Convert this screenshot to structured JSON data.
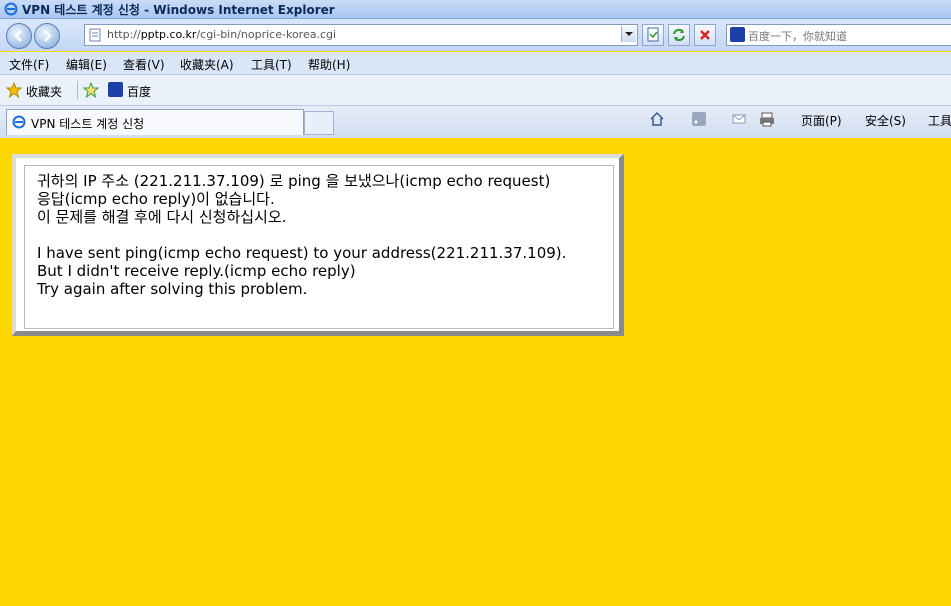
{
  "window": {
    "title": "VPN 테스트 계정 신청 - Windows Internet Explorer"
  },
  "address": {
    "url_prefix": "http://",
    "host": "pptp.co.kr",
    "path": "/cgi-bin/noprice-korea.cgi"
  },
  "search": {
    "placeholder": "百度一下，你就知道"
  },
  "menu": [
    "文件(F)",
    "编辑(E)",
    "查看(V)",
    "收藏夹(A)",
    "工具(T)",
    "帮助(H)"
  ],
  "favorites": {
    "favorites_label": "收藏夹",
    "baidu_label": "百度"
  },
  "tab": {
    "label": "VPN 테스트 계정 신청"
  },
  "commandbar": {
    "page": "页面(P)",
    "safety": "安全(S)",
    "tools": "工具"
  },
  "content": {
    "lines": [
      "귀하의 IP 주소 (221.211.37.109) 로 ping 을 보냈으나(icmp echo request)",
      "응답(icmp echo reply)이 없습니다.",
      "이 문제를 해결 후에 다시 신청하십시오.",
      "",
      "I have sent ping(icmp echo request) to your address(221.211.37.109).",
      "But I didn't receive reply.(icmp echo reply)",
      "Try again after solving this problem."
    ]
  },
  "colors": {
    "page_bg": "#ffd700",
    "box_bg": "#ffffff"
  },
  "icons": [
    "ie-icon",
    "back-icon",
    "forward-icon",
    "page-icon",
    "refresh-icon",
    "stop-icon",
    "star-icon",
    "add-favorite-icon",
    "baidu-paw-icon",
    "home-icon",
    "rss-icon",
    "mail-icon",
    "print-icon"
  ]
}
